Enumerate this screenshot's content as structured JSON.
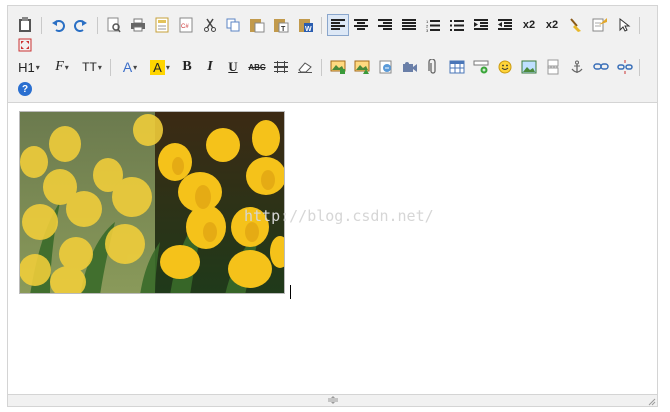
{
  "toolbar": {
    "heading_label": "H1",
    "fontfamily_label": "F",
    "fontsize_label": "TT",
    "forecolor_label": "A",
    "backcolor_label": "A",
    "bold_label": "B",
    "italic_label": "I",
    "underline_label": "U",
    "strikethrough_label": "ABC",
    "subscript_label": "x2",
    "superscript_label": "x2",
    "help_label": "?"
  },
  "content": {
    "image_alt": "yellow tulips photo",
    "watermark": "http://blog.csdn.net/"
  },
  "colors": {
    "toolbar_bg": "#f1f1f1",
    "border": "#d4d4d4",
    "tulip_yellow": "#f2c21c",
    "leaf_green": "#3a6b2a"
  }
}
